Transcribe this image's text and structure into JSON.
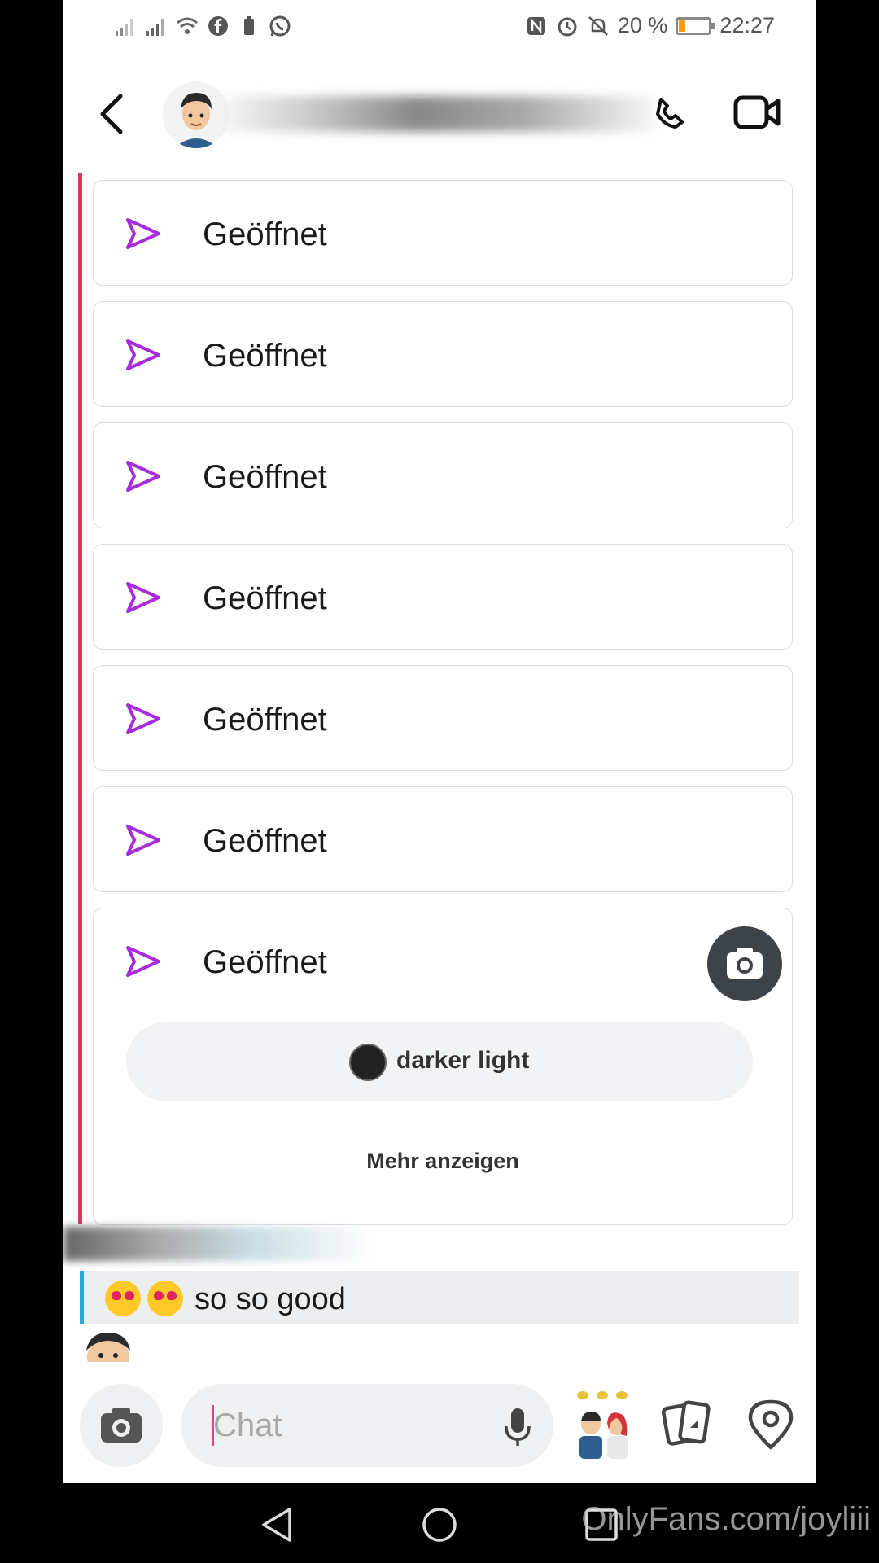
{
  "status_bar": {
    "battery": "20 %",
    "time": "22:27"
  },
  "header": {
    "contact_name": ""
  },
  "snaps": [
    {
      "status": "Geöffnet"
    },
    {
      "status": "Geöffnet"
    },
    {
      "status": "Geöffnet"
    },
    {
      "status": "Geöffnet"
    },
    {
      "status": "Geöffnet"
    },
    {
      "status": "Geöffnet"
    },
    {
      "status": "Geöffnet"
    }
  ],
  "shared_story": {
    "name": "darker light",
    "more_label": "Mehr anzeigen"
  },
  "message": {
    "text": "so so good"
  },
  "composer": {
    "placeholder": "Chat"
  },
  "watermark": "OnlyFans.com/joyliii",
  "colors": {
    "accent_purple": "#a82bdc",
    "sent_bar": "#d9365a",
    "received_bar": "#2ba6de",
    "camera_bubble": "#3e4347"
  }
}
